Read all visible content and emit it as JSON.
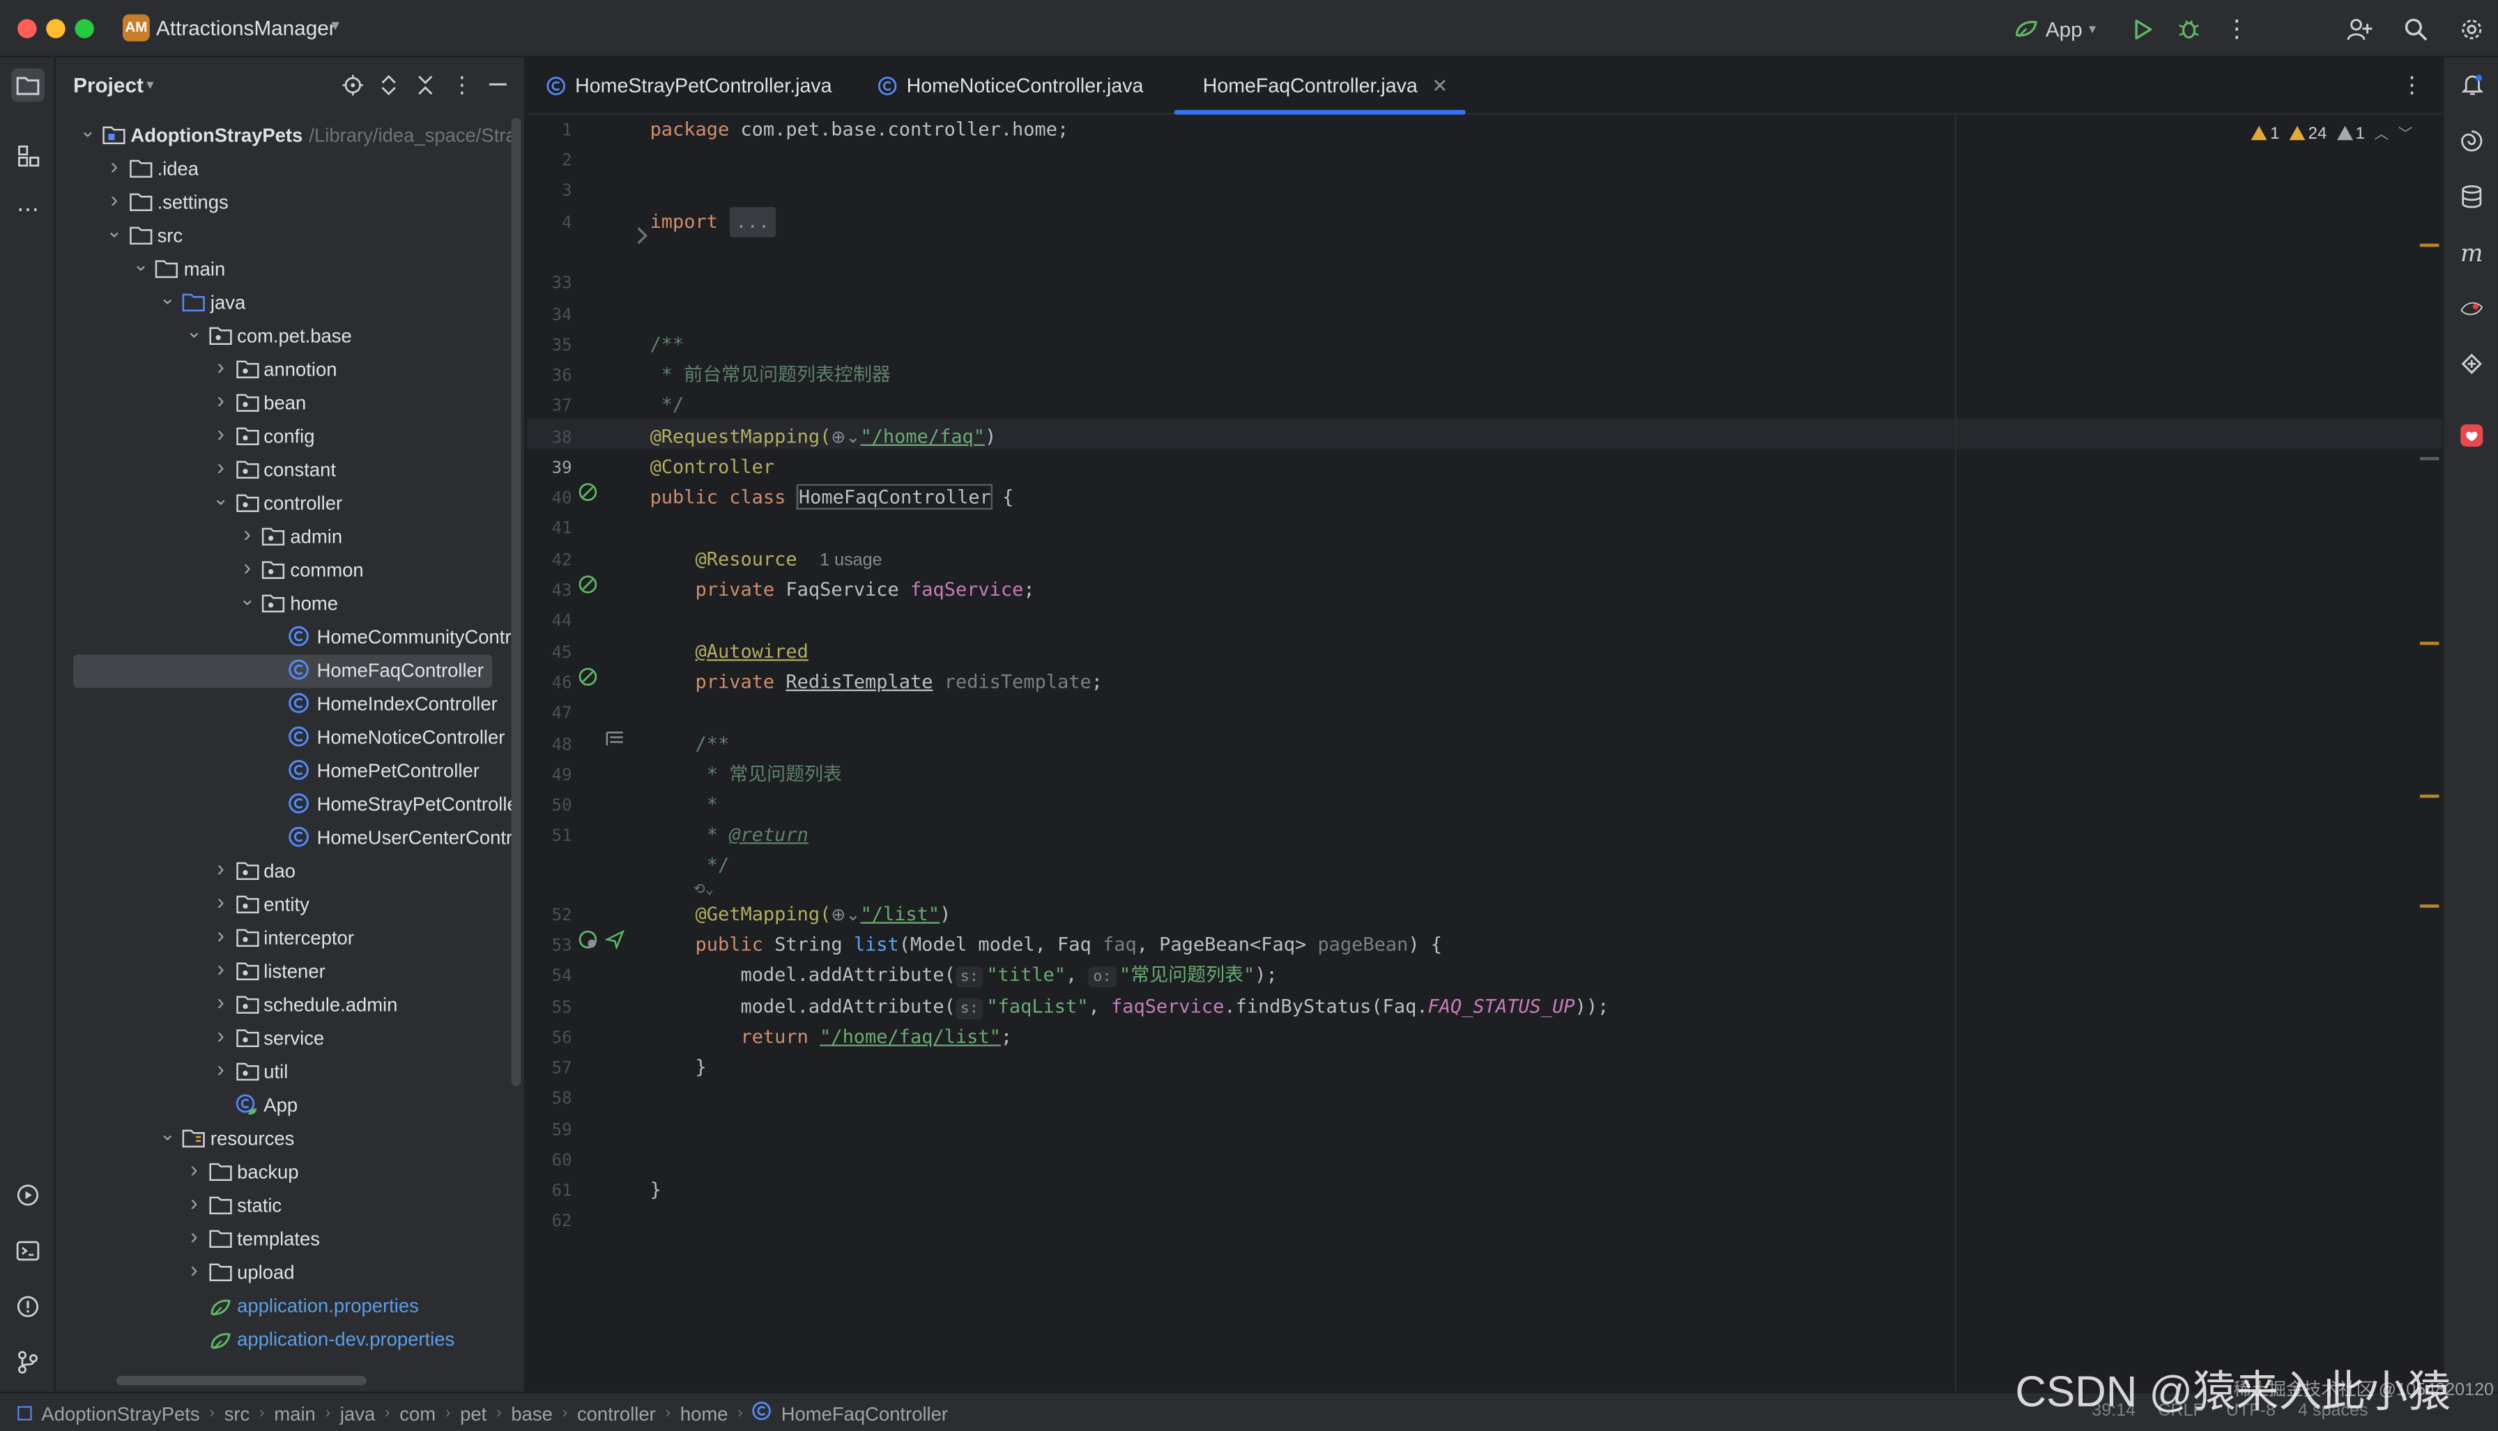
{
  "window": {
    "project_badge": "AM",
    "project_name": "AttractionsManager"
  },
  "toolbar": {
    "run_config": "App"
  },
  "project_panel": {
    "title": "Project",
    "tree": [
      {
        "label": "AdoptionStrayPets",
        "path": "/Library/idea_space/Stra",
        "bold": true,
        "depth": 0,
        "expanded": true,
        "icon": "module"
      },
      {
        "label": ".idea",
        "depth": 1,
        "expanded": false,
        "icon": "folder"
      },
      {
        "label": ".settings",
        "depth": 1,
        "expanded": false,
        "icon": "folder"
      },
      {
        "label": "src",
        "depth": 1,
        "expanded": true,
        "icon": "folder"
      },
      {
        "label": "main",
        "depth": 2,
        "expanded": true,
        "icon": "folder"
      },
      {
        "label": "java",
        "depth": 3,
        "expanded": true,
        "icon": "source-folder"
      },
      {
        "label": "com.pet.base",
        "depth": 4,
        "expanded": true,
        "icon": "package"
      },
      {
        "label": "annotion",
        "depth": 5,
        "expanded": false,
        "icon": "package"
      },
      {
        "label": "bean",
        "depth": 5,
        "expanded": false,
        "icon": "package"
      },
      {
        "label": "config",
        "depth": 5,
        "expanded": false,
        "icon": "package"
      },
      {
        "label": "constant",
        "depth": 5,
        "expanded": false,
        "icon": "package"
      },
      {
        "label": "controller",
        "depth": 5,
        "expanded": true,
        "icon": "package"
      },
      {
        "label": "admin",
        "depth": 6,
        "expanded": false,
        "icon": "package"
      },
      {
        "label": "common",
        "depth": 6,
        "expanded": false,
        "icon": "package"
      },
      {
        "label": "home",
        "depth": 6,
        "expanded": true,
        "icon": "package"
      },
      {
        "label": "HomeCommunityContr",
        "depth": 7,
        "icon": "class"
      },
      {
        "label": "HomeFaqController",
        "depth": 7,
        "icon": "class",
        "selected": true
      },
      {
        "label": "HomeIndexController",
        "depth": 7,
        "icon": "class"
      },
      {
        "label": "HomeNoticeController",
        "depth": 7,
        "icon": "class"
      },
      {
        "label": "HomePetController",
        "depth": 7,
        "icon": "class"
      },
      {
        "label": "HomeStrayPetControlle",
        "depth": 7,
        "icon": "class"
      },
      {
        "label": "HomeUserCenterContr",
        "depth": 7,
        "icon": "class"
      },
      {
        "label": "dao",
        "depth": 5,
        "expanded": false,
        "icon": "package"
      },
      {
        "label": "entity",
        "depth": 5,
        "expanded": false,
        "icon": "package"
      },
      {
        "label": "interceptor",
        "depth": 5,
        "expanded": false,
        "icon": "package"
      },
      {
        "label": "listener",
        "depth": 5,
        "expanded": false,
        "icon": "package"
      },
      {
        "label": "schedule.admin",
        "depth": 5,
        "expanded": false,
        "icon": "package"
      },
      {
        "label": "service",
        "depth": 5,
        "expanded": false,
        "icon": "package"
      },
      {
        "label": "util",
        "depth": 5,
        "expanded": false,
        "icon": "package"
      },
      {
        "label": "App",
        "depth": 5,
        "icon": "spring-class"
      },
      {
        "label": "resources",
        "depth": 3,
        "expanded": true,
        "icon": "resources-folder"
      },
      {
        "label": "backup",
        "depth": 4,
        "expanded": false,
        "icon": "folder"
      },
      {
        "label": "static",
        "depth": 4,
        "expanded": false,
        "icon": "folder"
      },
      {
        "label": "templates",
        "depth": 4,
        "expanded": false,
        "icon": "folder"
      },
      {
        "label": "upload",
        "depth": 4,
        "expanded": false,
        "icon": "folder"
      },
      {
        "label": "application.properties",
        "depth": 4,
        "icon": "spring-file",
        "blue": true
      },
      {
        "label": "application-dev.properties",
        "depth": 4,
        "icon": "spring-file",
        "blue": true
      }
    ]
  },
  "tabs": [
    {
      "label": "HomeStrayPetController.java",
      "active": false
    },
    {
      "label": "HomeNoticeController.java",
      "active": false
    },
    {
      "label": "HomeFaqController.java",
      "active": true
    }
  ],
  "inspections": {
    "warnings_a": "1",
    "warnings_b": "24",
    "weak_warnings": "1"
  },
  "editor": {
    "line_numbers": [
      "1",
      "2",
      "3",
      "4",
      "33",
      "34",
      "35",
      "36",
      "37",
      "38",
      "39",
      "40",
      "41",
      "42",
      "43",
      "44",
      "45",
      "46",
      "47",
      "48",
      "49",
      "50",
      "51",
      "",
      "52",
      "53",
      "54",
      "55",
      "56",
      "57",
      "58",
      "59",
      "60",
      "61",
      "62"
    ],
    "current_line": "39",
    "code": {
      "l1_kw": "package",
      "l1_rest": " com.pet.base.controller.home;",
      "l4_kw": "import ",
      "l4_fold": "...",
      "l34": "/**",
      "l35": " * 前台常见问题列表控制器",
      "l36": " */",
      "l37_ann": "@RequestMapping(",
      "l37_str": "\"/home/faq\"",
      "l37_end": ")",
      "l38_ann": "@Controller",
      "l39_kw": "public class ",
      "l39_cls": "HomeFaqController",
      "l39_end": " {",
      "l41_ann": "@Resource",
      "l41_hint": "1 usage",
      "l42_kw": "private ",
      "l42_type": "FaqService ",
      "l42_fld": "faqService",
      "l42_end": ";",
      "l44_ann": "@Autowired",
      "l45_kw": "private ",
      "l45_type": "RedisTemplate",
      "l45_fld": " redisTemplate",
      "l45_end": ";",
      "l47": "/**",
      "l48": " * 常见问题列表",
      "l49": " *",
      "l50_pre": " * ",
      "l50_tag": "@return",
      "l51": " */",
      "l52_ann": "@GetMapping(",
      "l52_str": "\"/list\"",
      "l52_end": ")",
      "l53_kw": "public ",
      "l53_type": "String ",
      "l53_fn": "list",
      "l53_a": "(Model model, Faq ",
      "l53_p1": "faq",
      "l53_b": ", PageBean<Faq> ",
      "l53_p2": "pageBean",
      "l53_c": ") {",
      "l54_a": "model.addAttribute(",
      "l54_h1": "s:",
      "l54_s1": "\"title\"",
      "l54_b": ", ",
      "l54_h2": "o:",
      "l54_s2": "\"常见问题列表\"",
      "l54_c": ");",
      "l55_a": "model.addAttribute(",
      "l55_h1": "s:",
      "l55_s1": "\"faqList\"",
      "l55_b": ", ",
      "l55_fld": "faqService",
      "l55_c": ".findByStatus(Faq.",
      "l55_const": "FAQ_STATUS_UP",
      "l55_d": "));",
      "l56_kw": "return ",
      "l56_str": "\"/home/faq/list\"",
      "l56_end": ";",
      "l57": "}",
      "l61": "}"
    }
  },
  "statusbar": {
    "breadcrumbs": [
      "AdoptionStrayPets",
      "src",
      "main",
      "java",
      "com",
      "pet",
      "base",
      "controller",
      "home",
      "HomeFaqController"
    ],
    "position": "39:14",
    "line_sep": "CRLF",
    "encoding": "UTF-8",
    "indent": "4 spaces"
  },
  "watermark": {
    "main": "CSDN @猿来入此小猿",
    "small": "稀土掘金技术社区 @1054820120"
  },
  "colors": {
    "accent": "#3574f0",
    "bg": "#1e1f22",
    "panel": "#2b2d30",
    "keyword": "#cf8e6d",
    "string": "#6aab73",
    "annotation": "#b3ae60"
  }
}
